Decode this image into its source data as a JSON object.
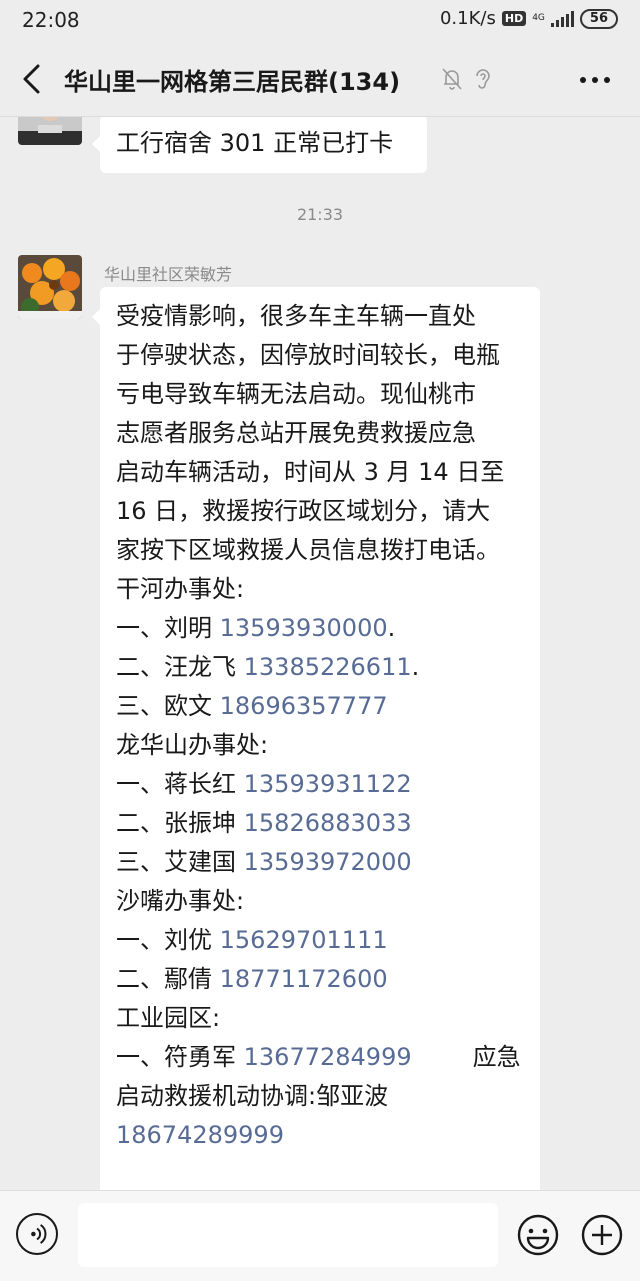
{
  "status_bar": {
    "time": "22:08",
    "network_speed": "0.1K/s",
    "hd_badge": "HD",
    "network_type": "4G",
    "battery": "56"
  },
  "header": {
    "title": "华山里一网格第三居民群(134)",
    "back_icon": "chevron-left-icon",
    "mute_icon": "bell-off-icon",
    "earpiece_icon": "ear-icon",
    "more_icon": "more-dots-icon"
  },
  "messages": {
    "prev": {
      "text": "工行宿舍 301 正常已打卡"
    },
    "timestamp": "21:33",
    "main": {
      "sender": "华山里社区荣敏芳",
      "lines": [
        [
          {
            "t": "受疫情影响，很多车主车辆一直处"
          }
        ],
        [
          {
            "t": "于停驶状态，因停放时间较长，电瓶"
          }
        ],
        [
          {
            "t": "亏电导致车辆无法启动。现仙桃市"
          }
        ],
        [
          {
            "t": "志愿者服务总站开展免费救援应急"
          }
        ],
        [
          {
            "t": "启动车辆活动，时间从 3 月 14 日至"
          }
        ],
        [
          {
            "t": "16 日，救援按行政区域划分，请大"
          }
        ],
        [
          {
            "t": "家按下区域救援人员信息拨打电话。"
          }
        ],
        [
          {
            "t": "干河办事处:"
          }
        ],
        [
          {
            "t": "一、刘明 "
          },
          {
            "p": "13593930000"
          },
          {
            "t": "."
          }
        ],
        [
          {
            "t": "二、汪龙飞 "
          },
          {
            "p": "13385226611"
          },
          {
            "t": "."
          }
        ],
        [
          {
            "t": "三、欧文 "
          },
          {
            "p": "18696357777"
          }
        ],
        [
          {
            "t": "龙华山办事处:"
          }
        ],
        [
          {
            "t": "一、蒋长红 "
          },
          {
            "p": "13593931122"
          }
        ],
        [
          {
            "t": "二、张振坤 "
          },
          {
            "p": "15826883033"
          }
        ],
        [
          {
            "t": "三、艾建国 "
          },
          {
            "p": "13593972000"
          }
        ],
        [
          {
            "t": "沙嘴办事处:"
          }
        ],
        [
          {
            "t": "一、刘优 "
          },
          {
            "p": "15629701111"
          }
        ],
        [
          {
            "t": "二、鄢倩 "
          },
          {
            "p": "18771172600"
          }
        ],
        [
          {
            "t": "工业园区:"
          }
        ],
        [
          {
            "t": "一、符勇军 "
          },
          {
            "p": "13677284999"
          },
          {
            "t": "        应急"
          }
        ],
        [
          {
            "t": "启动救援机动协调:邹亚波"
          }
        ],
        [
          {
            "p": "18674289999"
          }
        ]
      ]
    }
  },
  "input_bar": {
    "voice_icon": "voice-icon",
    "input_value": "",
    "emoji_icon": "emoji-icon",
    "plus_icon": "plus-circle-icon"
  },
  "colors": {
    "background": "#ededed",
    "bubble": "#ffffff",
    "link": "#576b95"
  }
}
